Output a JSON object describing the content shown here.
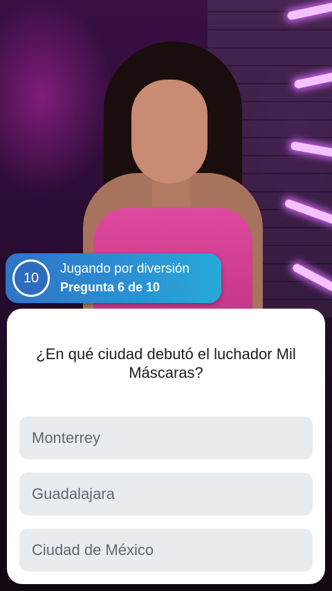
{
  "header": {
    "timer_value": "10",
    "mode_label": "Jugando por diversión",
    "question_counter": "Pregunta 6 de 10"
  },
  "quiz": {
    "question": "¿En qué ciudad debutó el luchador Mil Máscaras?",
    "answers": [
      {
        "label": "Monterrey"
      },
      {
        "label": "Guadalajara"
      },
      {
        "label": "Ciudad de México"
      }
    ]
  },
  "colors": {
    "banner_start": "#2f73c6",
    "banner_end": "#28a9d9",
    "answer_background": "#e9ecef",
    "answer_text": "#5e6770",
    "question_text": "#1c1c1c"
  }
}
